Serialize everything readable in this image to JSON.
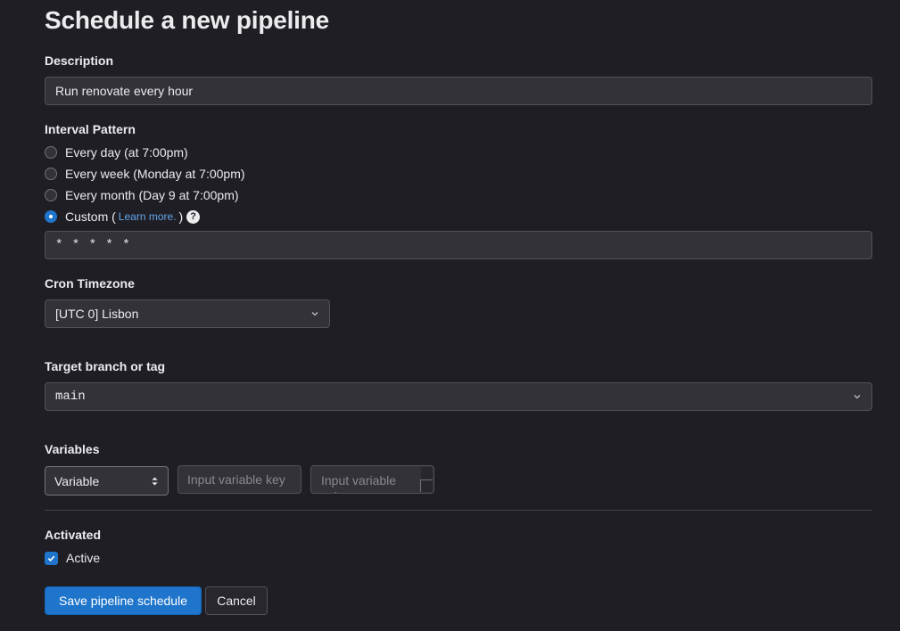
{
  "page": {
    "title": "Schedule a new pipeline"
  },
  "description": {
    "label": "Description",
    "value": "Run renovate every hour"
  },
  "interval": {
    "label": "Interval Pattern",
    "options": [
      {
        "label": "Every day (at 7:00pm)",
        "checked": false
      },
      {
        "label": "Every week (Monday at 7:00pm)",
        "checked": false
      },
      {
        "label": "Every month (Day 9 at 7:00pm)",
        "checked": false
      },
      {
        "label": "Custom (",
        "checked": true
      }
    ],
    "learn_more": "Learn more.",
    "close_paren": ")",
    "help_icon": "question-circle-icon",
    "cron_value": "* * * * *"
  },
  "timezone": {
    "label": "Cron Timezone",
    "selected": "[UTC 0] Lisbon",
    "icon": "chevron-down-icon"
  },
  "target": {
    "label": "Target branch or tag",
    "selected": "main",
    "icon": "chevron-down-icon"
  },
  "variables": {
    "label": "Variables",
    "type_selected": "Variable",
    "type_icon": "sort-arrows-icon",
    "key_placeholder": "Input variable key",
    "value_placeholder": "Input variable value"
  },
  "activated": {
    "label": "Activated",
    "checkbox_label": "Active",
    "checked": true
  },
  "actions": {
    "save_label": "Save pipeline schedule",
    "cancel_label": "Cancel"
  },
  "colors": {
    "background": "#1f1e24",
    "input_bg": "#333238",
    "accent": "#1f75cb",
    "link": "#63a6e9"
  }
}
